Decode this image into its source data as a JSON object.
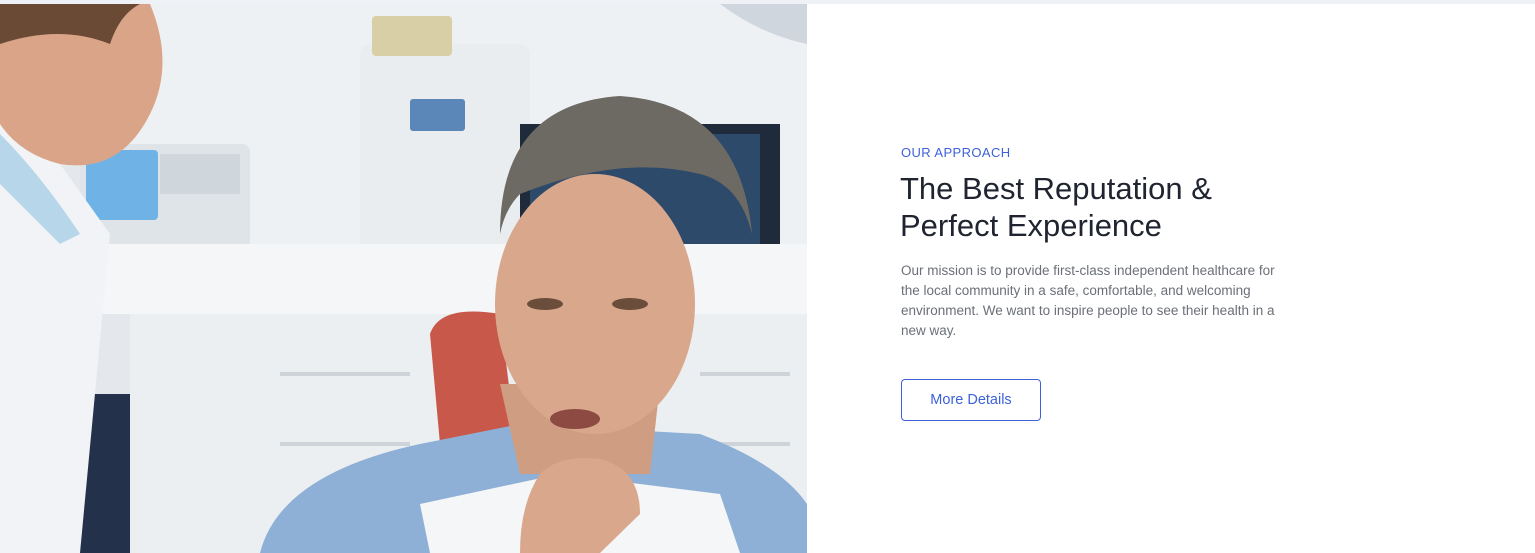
{
  "approach": {
    "eyebrow": "OUR APPROACH",
    "heading_line1": "The Best Reputation &",
    "heading_line2": "Perfect Experience",
    "description": "Our mission is to provide first-class independent healthcare for the local community in a safe, comfortable, and welcoming environment. We want to inspire people to see their health in a new way.",
    "button_label": "More Details"
  },
  "colors": {
    "accent": "#3d62d9",
    "heading": "#1f2430",
    "body_text": "#6b6f78"
  }
}
